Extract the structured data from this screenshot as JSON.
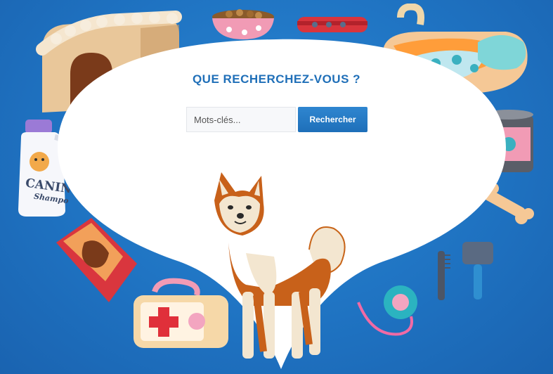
{
  "search": {
    "title": "QUE RECHERCHEZ-VOUS ?",
    "placeholder": "Mots-clés...",
    "button_label": "Rechercher"
  },
  "decor": {
    "shampoo_brand": "CANIN",
    "shampoo_sub": "Shampo"
  },
  "colors": {
    "background": "#1f73c2",
    "accent": "#1f6fb8",
    "button": "#2479c4"
  }
}
